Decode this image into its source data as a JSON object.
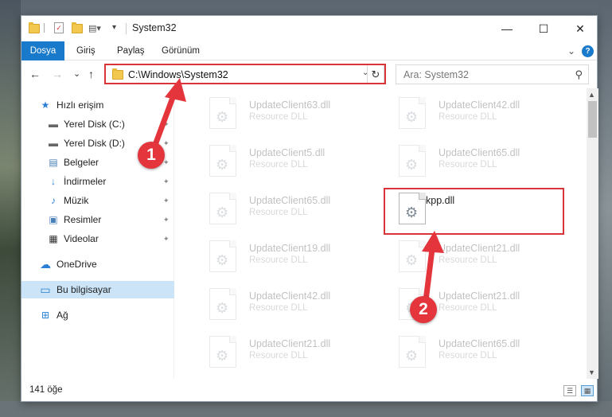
{
  "window": {
    "title": "System32",
    "minimize_glyph": "—",
    "maximize_glyph": "☐",
    "close_glyph": "✕"
  },
  "ribbon": {
    "tabs": [
      "Dosya",
      "Giriş",
      "Paylaş",
      "Görünüm"
    ],
    "expand_glyph": "⌄",
    "help_glyph": "?"
  },
  "nav": {
    "back_glyph": "←",
    "forward_glyph": "→",
    "recent_glyph": "⌄",
    "up_glyph": "↑",
    "address": "C:\\Windows\\System32",
    "address_dropdown_glyph": "⌄",
    "refresh_glyph": "↻",
    "search_placeholder": "Ara: System32",
    "search_glyph": "⚲"
  },
  "sidebar": {
    "items": [
      {
        "label": "Hızlı erişim",
        "icon": "star-icon",
        "glyph": "★",
        "pinned": false
      },
      {
        "label": "Yerel Disk (C:)",
        "icon": "drive-icon",
        "glyph": "▬",
        "pinned": true
      },
      {
        "label": "Yerel Disk (D:)",
        "icon": "drive-icon",
        "glyph": "▬",
        "pinned": true
      },
      {
        "label": "Belgeler",
        "icon": "documents-icon",
        "glyph": "▤",
        "pinned": true
      },
      {
        "label": "İndirmeler",
        "icon": "download-icon",
        "glyph": "↓",
        "pinned": true
      },
      {
        "label": "Müzik",
        "icon": "music-icon",
        "glyph": "♪",
        "pinned": true
      },
      {
        "label": "Resimler",
        "icon": "pictures-icon",
        "glyph": "▣",
        "pinned": true
      },
      {
        "label": "Videolar",
        "icon": "videos-icon",
        "glyph": "▦",
        "pinned": true
      },
      {
        "label": "OneDrive",
        "icon": "cloud-icon",
        "glyph": "☁",
        "pinned": false
      },
      {
        "label": "Bu bilgisayar",
        "icon": "computer-icon",
        "glyph": "▭",
        "pinned": false,
        "selected": true
      },
      {
        "label": "Ağ",
        "icon": "network-icon",
        "glyph": "⊞",
        "pinned": false
      }
    ],
    "pin_glyph": "✦"
  },
  "files": [
    {
      "name": "UpdateClient63.dll",
      "type": "Resource DLL"
    },
    {
      "name": "UpdateClient42.dll",
      "type": "Resource DLL"
    },
    {
      "name": "UpdateClient5.dll",
      "type": "Resource DLL"
    },
    {
      "name": "UpdateClient65.dll",
      "type": "Resource DLL"
    },
    {
      "name": "UpdateClient65.dll",
      "type": "Resource DLL"
    },
    {
      "name": "kpp.dll",
      "type": "",
      "active": true
    },
    {
      "name": "UpdateClient19.dll",
      "type": "Resource DLL"
    },
    {
      "name": "UpdateClient21.dll",
      "type": "Resource DLL"
    },
    {
      "name": "UpdateClient42.dll",
      "type": "Resource DLL"
    },
    {
      "name": "UpdateClient21.dll",
      "type": "Resource DLL"
    },
    {
      "name": "UpdateClient21.dll",
      "type": "Resource DLL"
    },
    {
      "name": "UpdateClient65.dll",
      "type": "Resource DLL"
    }
  ],
  "file_icon_glyph": "⚙",
  "status": {
    "count_text": "141 öğe",
    "details_view_glyph": "☰",
    "tiles_view_glyph": "▦"
  },
  "scrollbar": {
    "up_glyph": "▲",
    "down_glyph": "▼"
  },
  "annotations": {
    "marker1": "1",
    "marker2": "2",
    "highlight_color": "#d9343a"
  },
  "colors": {
    "accent": "#1979ca",
    "selection": "#cce4f7",
    "annotation": "#e4353d"
  }
}
